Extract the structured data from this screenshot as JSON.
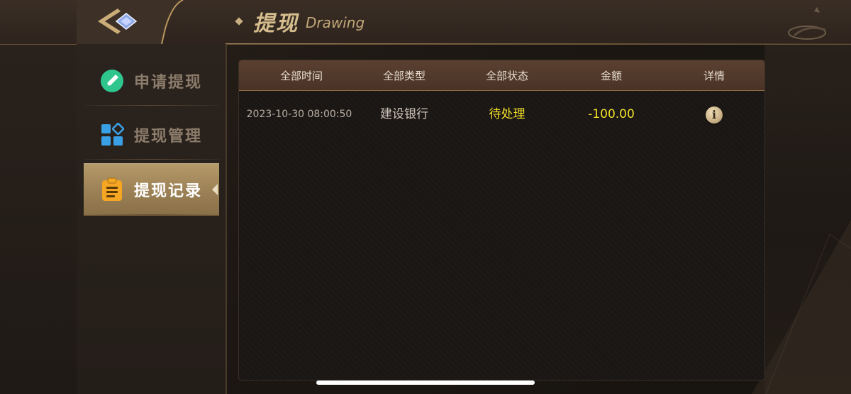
{
  "header": {
    "title_cn": "提现",
    "title_en": "Drawing",
    "back_icon": "back-diamond-icon"
  },
  "sidebar": {
    "items": [
      {
        "label": "申请提现",
        "icon": "pen-circle-icon",
        "active": false
      },
      {
        "label": "提现管理",
        "icon": "grid-squares-icon",
        "active": false
      },
      {
        "label": "提现记录",
        "icon": "clipboard-icon",
        "active": true
      }
    ]
  },
  "table": {
    "headers": [
      "全部时间",
      "全部类型",
      "全部状态",
      "金额",
      "详情"
    ],
    "rows": [
      {
        "time": "2023-10-30 08:00:50",
        "type": "建设银行",
        "status": "待处理",
        "amount": "-100.00",
        "detail_icon": "info-icon"
      }
    ]
  },
  "colors": {
    "accent_gold": "#c8ae80",
    "status_pending": "#f3e02a",
    "active_tab": "#a88d5f"
  }
}
